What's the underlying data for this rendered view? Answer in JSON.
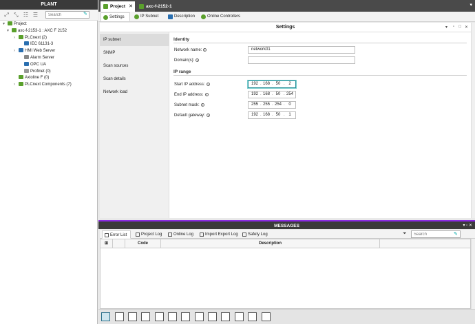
{
  "plant": {
    "title": "PLANT",
    "search_placeholder": "Search",
    "tree": [
      {
        "label": "Project",
        "icon": "project-folder-icon",
        "color": "#5aa02c"
      },
      {
        "label": "axc-f-2153-1 : AXC F 2152",
        "icon": "controller-icon",
        "color": "#5aa02c"
      },
      {
        "label": "PLCnext (2)",
        "icon": "plcnext-icon",
        "color": "#5aa02c"
      },
      {
        "label": "IEC 61131-3",
        "icon": "iec-icon",
        "color": "#2a6fb0"
      },
      {
        "label": "HMI Web Server",
        "icon": "hmi-icon",
        "color": "#2a6fb0"
      },
      {
        "label": "Alarm Server",
        "icon": "alarm-icon",
        "color": "#888888"
      },
      {
        "label": "OPC UA",
        "icon": "opcua-icon",
        "color": "#2a6fb0"
      },
      {
        "label": "Profinet (0)",
        "icon": "profinet-icon",
        "color": "#999999"
      },
      {
        "label": "Axioline F (0)",
        "icon": "axioline-icon",
        "color": "#5aa02c"
      },
      {
        "label": "PLCnext Components (7)",
        "icon": "components-icon",
        "color": "#5aa02c"
      }
    ]
  },
  "doc_tabs": [
    {
      "label": "Project",
      "icon": "project-icon",
      "color": "#5aa02c"
    },
    {
      "label": "axc-f-2152-1",
      "icon": "controller-icon",
      "color": "#5aa02c"
    }
  ],
  "sub_tabs": [
    {
      "label": "Settings",
      "icon": "settings-icon",
      "color": "#5aa02c"
    },
    {
      "label": "IP Subnet",
      "icon": "ip-subnet-icon",
      "color": "#5aa02c"
    },
    {
      "label": "Description",
      "icon": "description-icon",
      "color": "#2a6fb0"
    },
    {
      "label": "Online Controllers",
      "icon": "online-controllers-icon",
      "color": "#5aa02c"
    }
  ],
  "settings": {
    "title": "Settings",
    "nav": [
      "IP subnet",
      "SNMP",
      "Scan sources",
      "Scan details",
      "Network load"
    ],
    "identity_title": "Identity",
    "network_name_label": "Network name:",
    "network_name_value": "network01",
    "domains_label": "Domain(s):",
    "domains_value": "",
    "ip_range_title": "IP range",
    "fields": [
      {
        "label": "Start IP address:",
        "octets": [
          "192",
          "168",
          "50",
          "2"
        ]
      },
      {
        "label": "End IP address:",
        "octets": [
          "192",
          "168",
          "50",
          "254"
        ]
      },
      {
        "label": "Subnet mask:",
        "octets": [
          "255",
          "255",
          "254",
          "0"
        ]
      },
      {
        "label": "Default gateway:",
        "octets": [
          "192",
          "168",
          "50",
          "1"
        ]
      }
    ]
  },
  "messages": {
    "title": "MESSAGES",
    "tabs": [
      "Error List",
      "Project Log",
      "Online Log",
      "Import Export Log",
      "Safety Log"
    ],
    "search_placeholder": "Search",
    "columns": [
      "Code",
      "Description"
    ]
  },
  "colors": {
    "accent": "#2a8f9a",
    "dark_header": "#3a3a3a",
    "messages_accent": "#8a2be2"
  }
}
